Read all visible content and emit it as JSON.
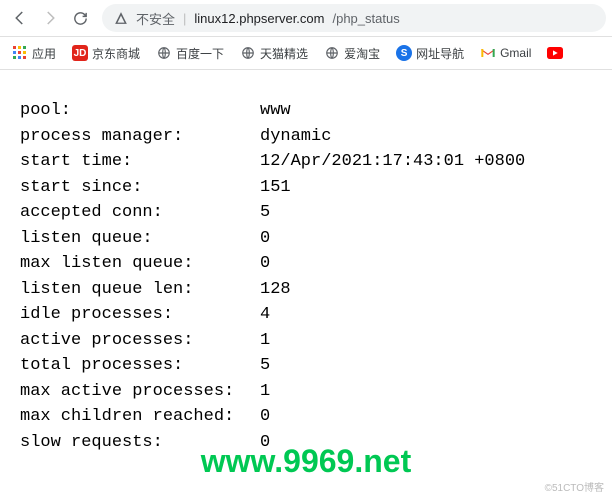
{
  "toolbar": {
    "security_label": "不安全",
    "url_host": "linux12.phpserver.com",
    "url_path": "/php_status"
  },
  "bookmarks": {
    "apps": "应用",
    "jd": "京东商城",
    "baidu": "百度一下",
    "tmall": "天猫精选",
    "aitaobao": "爱淘宝",
    "nav": "网址导航",
    "gmail": "Gmail"
  },
  "status": {
    "rows": [
      {
        "k": "pool:",
        "v": "www"
      },
      {
        "k": "process manager:",
        "v": "dynamic"
      },
      {
        "k": "start time:",
        "v": "12/Apr/2021:17:43:01 +0800"
      },
      {
        "k": "start since:",
        "v": "151"
      },
      {
        "k": "accepted conn:",
        "v": "5"
      },
      {
        "k": "listen queue:",
        "v": "0"
      },
      {
        "k": "max listen queue:",
        "v": "0"
      },
      {
        "k": "listen queue len:",
        "v": "128"
      },
      {
        "k": "idle processes:",
        "v": "4"
      },
      {
        "k": "active processes:",
        "v": "1"
      },
      {
        "k": "total processes:",
        "v": "5"
      },
      {
        "k": "max active processes:",
        "v": "1"
      },
      {
        "k": "max children reached:",
        "v": "0"
      },
      {
        "k": "slow requests:",
        "v": "0"
      }
    ]
  },
  "watermark": "www.9969.net",
  "corner_watermark": "©51CTO博客"
}
